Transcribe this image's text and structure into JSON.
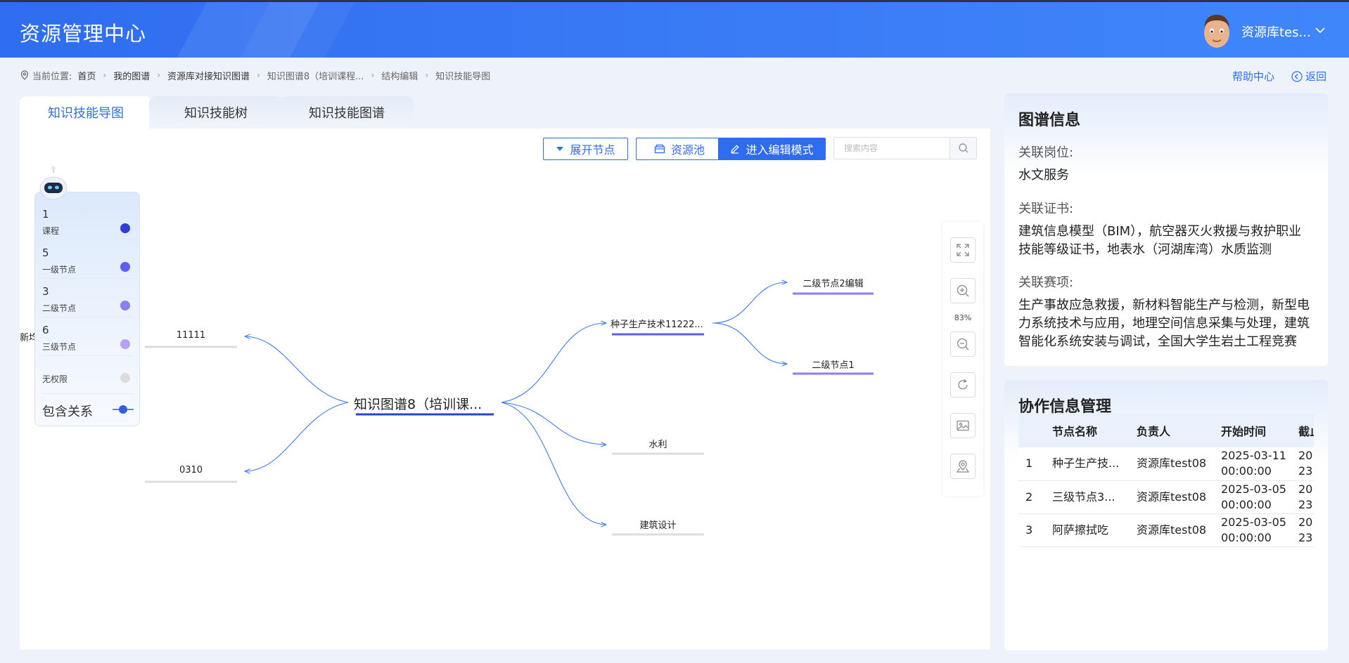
{
  "header": {
    "app_title": "资源管理中心",
    "user_name": "资源库tes..."
  },
  "breadcrumb": {
    "prefix": "当前位置:",
    "items": [
      "首页",
      "我的图谱",
      "资源库对接知识图谱",
      "知识图谱8（培训课程...",
      "结构编辑",
      "知识技能导图"
    ]
  },
  "top_links": {
    "help": "帮助中心",
    "back": "返回"
  },
  "tabs": [
    "知识技能导图",
    "知识技能树",
    "知识技能图谱"
  ],
  "toolbar": {
    "expand_label": "展开节点",
    "pool_label": "资源池",
    "edit_label": "进入编辑模式",
    "search_placeholder": "搜索内容"
  },
  "legend": {
    "items": [
      {
        "count": "1",
        "label": "课程",
        "color": "#2e3fd6"
      },
      {
        "count": "5",
        "label": "一级节点",
        "color": "#5b5ef0"
      },
      {
        "count": "3",
        "label": "二级节点",
        "color": "#8a7ef3"
      },
      {
        "count": "6",
        "label": "三级节点",
        "color": "#b6a1f3"
      }
    ],
    "no_auth": "无权限",
    "relation": "包含关系"
  },
  "mindmap": {
    "root": "知识图谱8（培训课...",
    "left_nodes": [
      "11111",
      "0310"
    ],
    "left_cut": "新均",
    "right_nodes": [
      "种子生产技术11222...",
      "水利",
      "建筑设计"
    ],
    "level2_nodes": [
      "二级节点2编辑",
      "二级节点1"
    ]
  },
  "zoom": {
    "level": "83%"
  },
  "graph_info": {
    "title": "图谱信息",
    "post_label": "关联岗位:",
    "post_value": "水文服务",
    "cert_label": "关联证书:",
    "cert_value": "建筑信息模型（BIM），航空器灭火救援与救护职业技能等级证书，地表水（河湖库湾）水质监测",
    "contest_label": "关联赛项:",
    "contest_value": "生产事故应急救援，新材料智能生产与检测，新型电力系统技术与应用，地理空间信息采集与处理，建筑智能化系统安装与调试，全国大学生岩土工程竞赛"
  },
  "collab": {
    "title": "协作信息管理",
    "columns": [
      "",
      "节点名称",
      "负责人",
      "开始时间",
      "截止"
    ],
    "rows": [
      {
        "idx": "1",
        "name": "种子生产技...",
        "owner": "资源库test08",
        "start_date": "2025-03-11",
        "start_time": "00:00:00",
        "end_date": "20",
        "end_time": "23"
      },
      {
        "idx": "2",
        "name": "三级节点3...",
        "owner": "资源库test08",
        "start_date": "2025-03-05",
        "start_time": "00:00:00",
        "end_date": "20",
        "end_time": "23"
      },
      {
        "idx": "3",
        "name": "阿萨擦拭吃",
        "owner": "资源库test08",
        "start_date": "2025-03-05",
        "start_time": "00:00:00",
        "end_date": "20",
        "end_time": "23"
      }
    ]
  }
}
